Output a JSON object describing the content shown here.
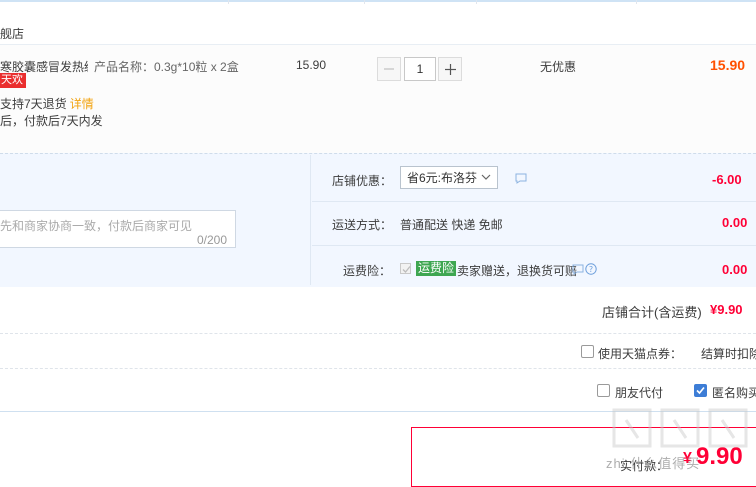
{
  "shop": {
    "name": "舰店"
  },
  "item": {
    "title": "寒胶囊感冒发热缓...",
    "spec": "产品名称：0.3g*10粒 x 2盒",
    "tag": "天欢",
    "service": "支持7天退货",
    "service_link": "详情",
    "shipping_promise": "后，付款后7天内发",
    "unit_price": "15.90",
    "quantity": "1",
    "discount": "无优惠",
    "total": "15.90"
  },
  "options": {
    "message_placeholder": "先和商家协商一致，付款后商家可见",
    "message_count": "0/200",
    "coupon_label": "店铺优惠：",
    "coupon_selected": "省6元:布洛芬",
    "coupon_amount": "-6.00",
    "delivery_label": "运送方式：",
    "delivery_value": "普通配送 快递 免邮",
    "delivery_amount": "0.00",
    "insurance_label": "运费险：",
    "insurance_badge": "运费险",
    "insurance_desc": "卖家赠送，退换货可赔",
    "insurance_amount": "0.00"
  },
  "summary": {
    "shop_total_label": "店铺合计(含运费)",
    "shop_total_value": "¥9.90",
    "tmall_points_label": "使用天猫点券：",
    "tmall_points_note": "结算时扣除",
    "friend_pay_label": "朋友代付",
    "anonymous_label": "匿名购买",
    "pay_label": "实付款：",
    "pay_currency": "¥",
    "pay_amount": "9.90"
  },
  "watermark": {
    "text": "zhi 什么值得买"
  },
  "colors": {
    "price": "#ff0036",
    "orange": "#ff5000",
    "accent_blue": "#3d7dd6",
    "insurance_green": "#3ea651"
  }
}
